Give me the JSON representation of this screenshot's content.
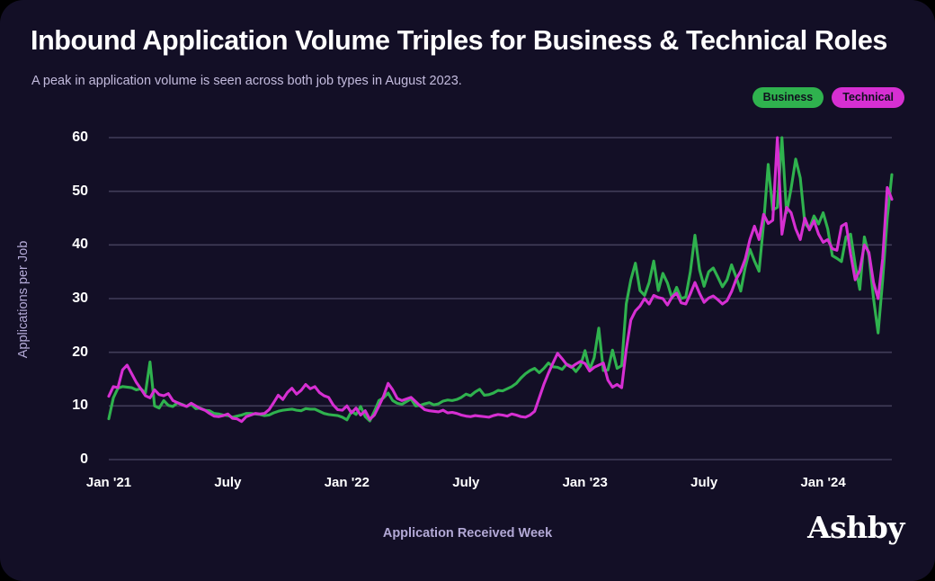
{
  "card": {
    "background": "#130f26",
    "title": "Inbound Application Volume Triples for Business & Technical Roles",
    "subtitle": "A peak in application volume is seen across both job types in August 2023.",
    "logo": "Ashby"
  },
  "legend": [
    {
      "label": "Business",
      "color": "#2fb24e"
    },
    {
      "label": "Technical",
      "color": "#d62fd2"
    }
  ],
  "chart_data": {
    "type": "line",
    "title": "Inbound Application Volume Triples for Business & Technical Roles",
    "subtitle": "A peak in application volume is seen across both job types in August 2023.",
    "xlabel": "Application Received Week",
    "ylabel": "Applications per Job",
    "ylim": [
      0,
      60
    ],
    "yticks": [
      0,
      10,
      20,
      30,
      40,
      50,
      60
    ],
    "xticks": [
      "Jan '21",
      "July",
      "Jan '22",
      "July",
      "Jan '23",
      "July",
      "Jan '24"
    ],
    "xtick_index": [
      0,
      26,
      52,
      78,
      104,
      130,
      156
    ],
    "grid": true,
    "legend_position": "top-right",
    "n_points": 172,
    "series": [
      {
        "name": "Business",
        "color": "#2fb24e",
        "values": [
          7.6,
          11.5,
          13.3,
          13.6,
          13.5,
          13.4,
          13.0,
          13.2,
          12.4,
          18.2,
          10.0,
          9.6,
          11.0,
          10.1,
          9.9,
          10.6,
          10.3,
          9.9,
          10.3,
          9.5,
          9.6,
          9.2,
          9.1,
          8.6,
          8.5,
          8.3,
          8.2,
          7.9,
          8.1,
          8.3,
          8.6,
          8.6,
          8.5,
          8.4,
          8.2,
          8.3,
          8.7,
          9.0,
          9.2,
          9.3,
          9.4,
          9.2,
          9.1,
          9.5,
          9.4,
          9.4,
          9.0,
          8.6,
          8.4,
          8.3,
          8.2,
          7.9,
          7.4,
          9.0,
          8.4,
          9.9,
          8.0,
          7.2,
          9.0,
          11.0,
          11.5,
          12.4,
          11.0,
          10.5,
          10.3,
          10.8,
          11.3,
          10.0,
          10.1,
          10.4,
          10.6,
          10.2,
          10.4,
          10.9,
          11.1,
          11.0,
          11.2,
          11.6,
          12.2,
          11.9,
          12.6,
          13.1,
          12.0,
          12.1,
          12.4,
          12.9,
          12.8,
          13.2,
          13.6,
          14.2,
          15.2,
          16.0,
          16.6,
          17.0,
          16.2,
          17.0,
          18.0,
          17.3,
          17.2,
          16.8,
          17.8,
          17.4,
          16.4,
          17.5,
          20.3,
          16.8,
          19.0,
          24.5,
          16.6,
          16.7,
          20.4,
          17.0,
          17.5,
          29.0,
          33.5,
          36.6,
          31.5,
          30.6,
          33.0,
          37.0,
          31.5,
          34.7,
          32.9,
          30.1,
          32.1,
          30.0,
          30.3,
          35.0,
          41.8,
          35.4,
          32.3,
          35.0,
          35.7,
          34.0,
          32.2,
          33.5,
          36.3,
          34.0,
          31.4,
          35.9,
          39.2,
          37.0,
          35.1,
          44.0,
          55.0,
          46.5,
          47.0,
          60.0,
          46.0,
          50.5,
          56.0,
          52.5,
          44.0,
          43.0,
          45.4,
          43.9,
          46.0,
          43.0,
          38.0,
          37.5,
          36.9,
          41.5,
          42.0,
          36.3,
          31.7,
          41.5,
          38.0,
          30.0,
          23.6,
          33.5,
          45.0,
          53.1
        ]
      },
      {
        "name": "Technical",
        "color": "#d62fd2",
        "values": [
          11.8,
          13.6,
          13.4,
          16.7,
          17.6,
          16.0,
          14.4,
          13.2,
          11.9,
          11.5,
          13.0,
          12.1,
          11.9,
          12.3,
          11.0,
          10.6,
          10.2,
          9.9,
          10.5,
          10.0,
          9.5,
          9.2,
          8.6,
          8.1,
          8.0,
          8.2,
          8.5,
          7.7,
          7.6,
          7.1,
          8.0,
          8.3,
          8.6,
          8.5,
          8.6,
          9.3,
          10.6,
          12.0,
          11.2,
          12.5,
          13.3,
          12.2,
          12.9,
          14.0,
          13.2,
          13.6,
          12.5,
          11.9,
          11.6,
          10.2,
          9.3,
          9.2,
          10.0,
          8.7,
          9.6,
          8.3,
          9.1,
          7.5,
          8.3,
          10.0,
          11.8,
          14.2,
          13.0,
          11.4,
          11.0,
          11.3,
          11.6,
          10.8,
          10.0,
          9.3,
          9.1,
          9.0,
          8.9,
          9.2,
          8.7,
          8.8,
          8.6,
          8.3,
          8.1,
          8.0,
          8.2,
          8.1,
          8.0,
          7.9,
          8.2,
          8.4,
          8.3,
          8.1,
          8.5,
          8.3,
          8.0,
          7.9,
          8.3,
          9.0,
          11.5,
          14.0,
          16.1,
          18.0,
          19.8,
          18.8,
          17.7,
          17.2,
          17.8,
          18.3,
          17.9,
          16.5,
          17.2,
          17.6,
          18.0,
          14.8,
          13.5,
          14.0,
          13.4,
          20.5,
          26.0,
          27.7,
          28.6,
          30.0,
          29.0,
          30.6,
          30.2,
          30.0,
          28.8,
          30.3,
          31.0,
          29.2,
          29.0,
          30.9,
          33.0,
          31.0,
          29.3,
          30.1,
          30.5,
          29.8,
          29.0,
          29.6,
          31.3,
          33.6,
          35.1,
          37.4,
          41.0,
          43.5,
          41.0,
          45.7,
          44.0,
          44.6,
          60.0,
          42.0,
          47.0,
          46.0,
          43.0,
          41.0,
          45.0,
          42.8,
          44.5,
          42.0,
          40.5,
          41.0,
          39.3,
          39.0,
          43.5,
          44.0,
          38.3,
          33.5,
          35.3,
          40.0,
          38.6,
          33.0,
          30.0,
          37.5,
          50.7,
          48.5
        ]
      }
    ]
  }
}
